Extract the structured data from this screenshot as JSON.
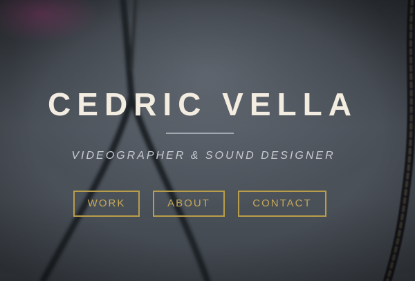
{
  "hero": {
    "name": "CEDRIC VELLA",
    "tagline": "VIDEOGRAPHER & SOUND DESIGNER"
  },
  "nav": {
    "items": [
      {
        "label": "WORK"
      },
      {
        "label": "ABOUT"
      },
      {
        "label": "CONTACT"
      }
    ]
  },
  "colors": {
    "title": "#f3ece0",
    "tagline": "#c7cbd1",
    "nav_accent": "#b89d4a",
    "background": "#3a3f45"
  },
  "icons": [
    "rope-image"
  ]
}
